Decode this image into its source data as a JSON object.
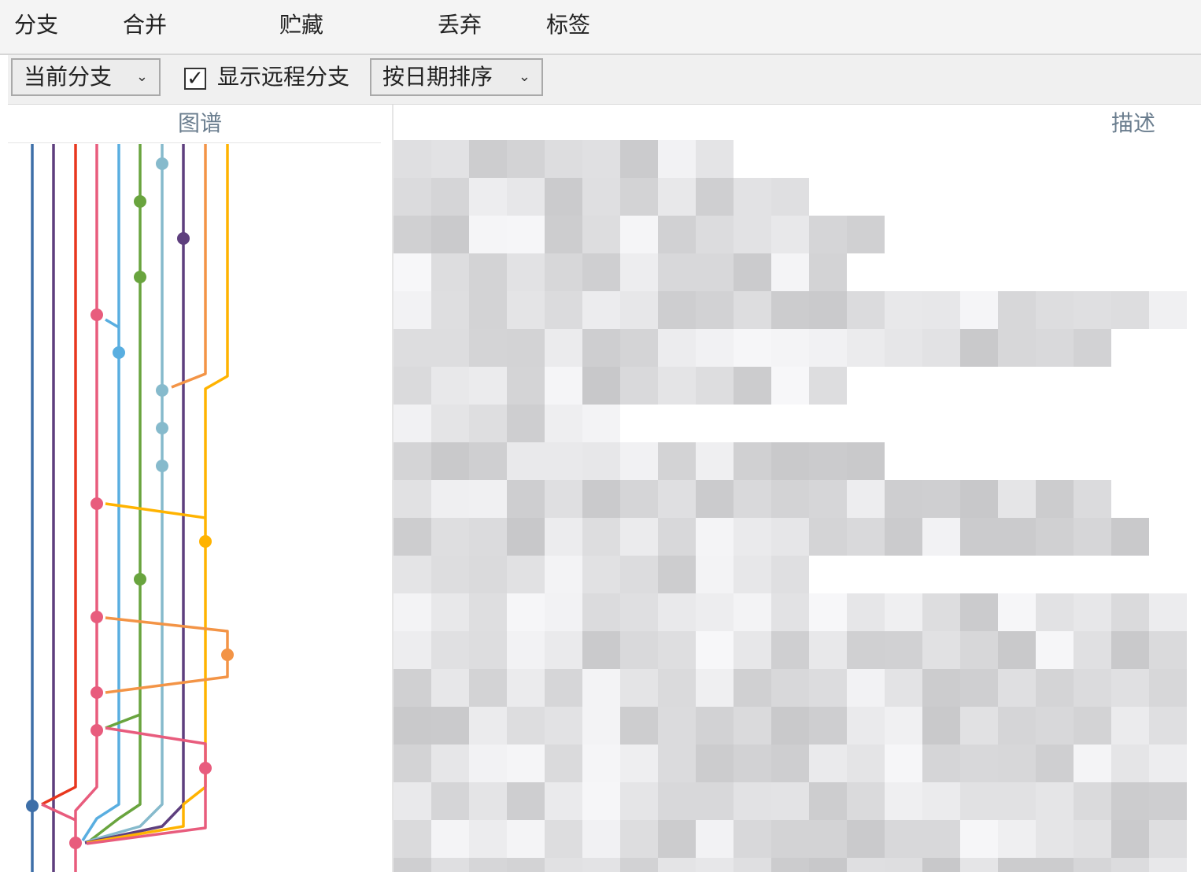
{
  "menu": {
    "branch": "分支",
    "merge": "合并",
    "stash": "贮藏",
    "discard": "丢弃",
    "tag": "标签"
  },
  "toolbar": {
    "branch_filter": "当前分支",
    "show_remote_label": "显示远程分支",
    "show_remote_checked": true,
    "sort_order": "按日期排序",
    "chevron_icon": "chevron-down-icon"
  },
  "columns": {
    "graph": "图谱",
    "description": "描述"
  },
  "colors": {
    "accent_text": "#6a7d8e",
    "lane_blue": "#3d6fa8",
    "lane_purple": "#5e3f7e",
    "lane_red": "#e8371e",
    "lane_pink": "#e85c7d",
    "lane_lightblue": "#59aee0",
    "lane_green": "#69a43e",
    "lane_teal": "#86bacc",
    "lane_orange": "#f39446",
    "lane_yellow": "#ffb300"
  }
}
